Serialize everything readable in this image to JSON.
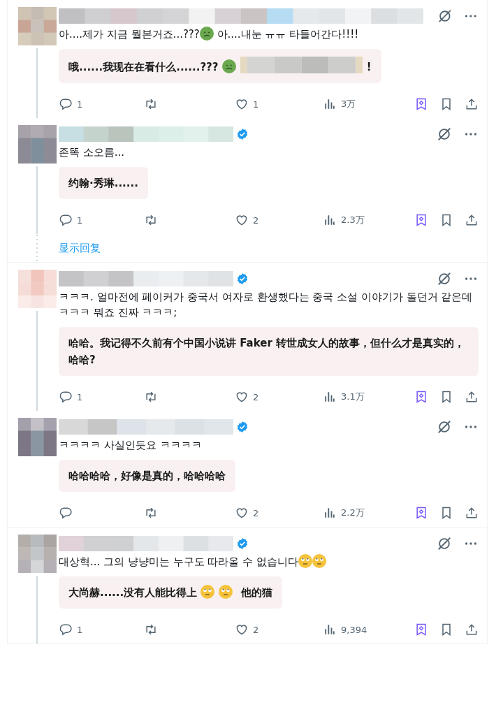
{
  "threads": [
    {
      "tweets": [
        {
          "verified": false,
          "thread_line": true,
          "text": [
            {
              "kind": "text",
              "text": "아....제가 지금 뭘본거죠...???"
            },
            {
              "kind": "sick-emoji"
            },
            {
              "kind": "text",
              "text": " 아....내눈 ㅠㅠ 타들어간다!!!!"
            }
          ],
          "translation": [
            {
              "kind": "text",
              "text": "哦......我现在在看什么......??? "
            },
            {
              "kind": "sick-emoji"
            },
            {
              "kind": "blur"
            },
            {
              "kind": "text",
              "text": "!"
            }
          ],
          "replies": "1",
          "likes": "1",
          "views": "3万"
        },
        {
          "verified": true,
          "thread_line": true,
          "text": [
            {
              "kind": "text",
              "text": "존똑 소오름..."
            }
          ],
          "translation": [
            {
              "kind": "text",
              "text": "约翰·秀琳......"
            }
          ],
          "replies": "1",
          "likes": "2",
          "views": "2.3万"
        }
      ],
      "show_replies": "显示回复"
    },
    {
      "tweets": [
        {
          "verified": true,
          "thread_line": true,
          "text": [
            {
              "kind": "text",
              "text": "ㅋㅋㅋ. 얼마전에 페이커가 중국서 여자로 환생했다는 중국 소설 이야기가 돌던거 같은데 ㅋㅋㅋ 뭐죠 진짜 ㅋㅋㅋ;"
            }
          ],
          "translation": [
            {
              "kind": "text",
              "text": "哈哈。我记得不久前有个中国小说讲 Faker 转世成女人的故事，但什么才是真实的，哈哈?"
            }
          ],
          "replies": "1",
          "likes": "2",
          "views": "3.1万"
        },
        {
          "verified": true,
          "thread_line": false,
          "text": [
            {
              "kind": "text",
              "text": "ㅋㅋㅋㅋ 사실인듯요 ㅋㅋㅋㅋ"
            }
          ],
          "translation": [
            {
              "kind": "text",
              "text": "哈哈哈哈，好像是真的，哈哈哈哈"
            }
          ],
          "likes": "2",
          "views": "2.2万"
        }
      ]
    },
    {
      "tweets": [
        {
          "verified": true,
          "thread_line": true,
          "text": [
            {
              "kind": "text",
              "text": "대상혁... 그의 냥냥미는 누구도 따라올 수 없습니다"
            },
            {
              "kind": "eyeroll-emoji"
            },
            {
              "kind": "eyeroll-emoji"
            }
          ],
          "translation": [
            {
              "kind": "text",
              "text": "大尚赫......没有人能比得上 "
            },
            {
              "kind": "eyeroll-emoji"
            },
            {
              "kind": "eyeroll-emoji"
            },
            {
              "kind": "text",
              "text": " 他的猫"
            }
          ],
          "replies": "1",
          "likes": "2",
          "views": "9,394"
        }
      ]
    }
  ]
}
